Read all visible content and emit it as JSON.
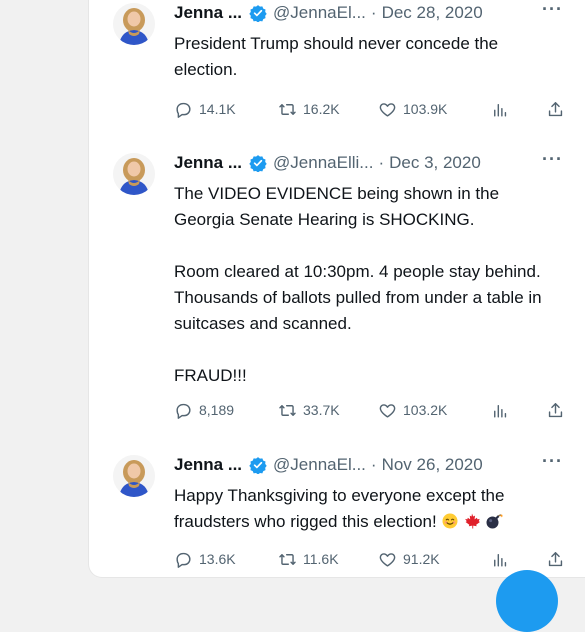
{
  "colors": {
    "verified": "#1d9bf0",
    "text": "#0f1419",
    "secondary": "#536471",
    "fab": "#1d9bf0"
  },
  "tweets": [
    {
      "name": "Jenna ...",
      "handle": "@JennaEl...",
      "separator": "·",
      "date": "Dec 28, 2020",
      "more": "···",
      "paragraphs": [
        "President Trump should never concede the election."
      ],
      "emojis": [],
      "replies": "14.1K",
      "retweets": "16.2K",
      "likes": "103.9K"
    },
    {
      "name": "Jenna ...",
      "handle": "@JennaElli...",
      "separator": "·",
      "date": "Dec 3, 2020",
      "more": "···",
      "paragraphs": [
        "The VIDEO EVIDENCE being shown in the Georgia Senate Hearing is SHOCKING.",
        "Room cleared at 10:30pm. 4 people stay behind. Thousands of ballots pulled from under a table in suitcases and scanned.",
        "FRAUD!!!"
      ],
      "emojis": [],
      "replies": "8,189",
      "retweets": "33.7K",
      "likes": "103.2K"
    },
    {
      "name": "Jenna ...",
      "handle": "@JennaEl...",
      "separator": "·",
      "date": "Nov 26, 2020",
      "more": "···",
      "paragraphs": [
        "Happy Thanksgiving to everyone except the fraudsters who rigged this election!"
      ],
      "emojis": [
        "smiling-face-emoji",
        "maple-leaf-emoji",
        "bomb-emoji"
      ],
      "replies": "13.6K",
      "retweets": "11.6K",
      "likes": "91.2K"
    }
  ]
}
